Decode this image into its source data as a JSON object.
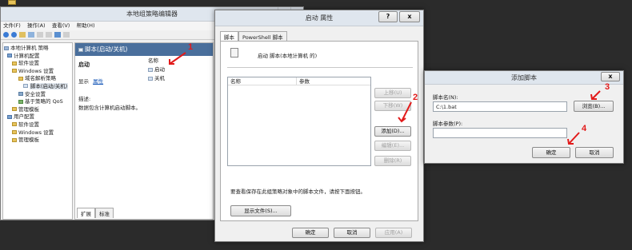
{
  "taskbar_icon": "app-icon",
  "gpedit": {
    "title": "本地组策略编辑器",
    "menu": [
      "文件(F)",
      "操作(A)",
      "查看(V)",
      "帮助(H)"
    ],
    "tree": [
      "本地计算机 策略",
      "计算机配置",
      "软件设置",
      "Windows 设置",
      "域名解析策略",
      "脚本(启动/关机)",
      "安全设置",
      "基于策略的 QoS",
      "管理模板",
      "用户配置",
      "软件设置",
      "Windows 设置",
      "管理模板"
    ],
    "header_title": "脚本(启动/关机)",
    "detail_heading": "启动",
    "display_label": "显示",
    "properties_link": "属性",
    "desc_label": "描述:",
    "desc_text": "数据包含计算机启动脚本。",
    "col_name": "名称",
    "items": [
      "启动",
      "关机"
    ],
    "tabs": [
      "扩展",
      "标准"
    ]
  },
  "props": {
    "title": "启动 属性",
    "help": "?",
    "close": "x",
    "tabs": [
      "脚本",
      "PowerShell 脚本"
    ],
    "script_desc": "启动 脚本(本地计算机 的)",
    "col_name": "名称",
    "col_params": "参数",
    "btn_up": "上移(U)",
    "btn_down": "下移(W)",
    "btn_add": "添加(D)...",
    "btn_edit": "编辑(E)...",
    "btn_remove": "删除(R)",
    "note": "要查看保存在此组策略对象中的脚本文件，请按下面按钮。",
    "btn_show_files": "显示文件(S)...",
    "btn_ok": "确定",
    "btn_cancel": "取消",
    "btn_apply": "应用(A)"
  },
  "add_script": {
    "title": "添加脚本",
    "close": "x",
    "name_label": "脚本名(N):",
    "name_value": "C:\\1.bat",
    "btn_browse": "浏览(B)...",
    "params_label": "脚本参数(P):",
    "params_value": "",
    "btn_ok": "确定",
    "btn_cancel": "取消"
  },
  "annotations": [
    "1",
    "2",
    "3",
    "4"
  ],
  "annotation_color": "#e21a1a"
}
